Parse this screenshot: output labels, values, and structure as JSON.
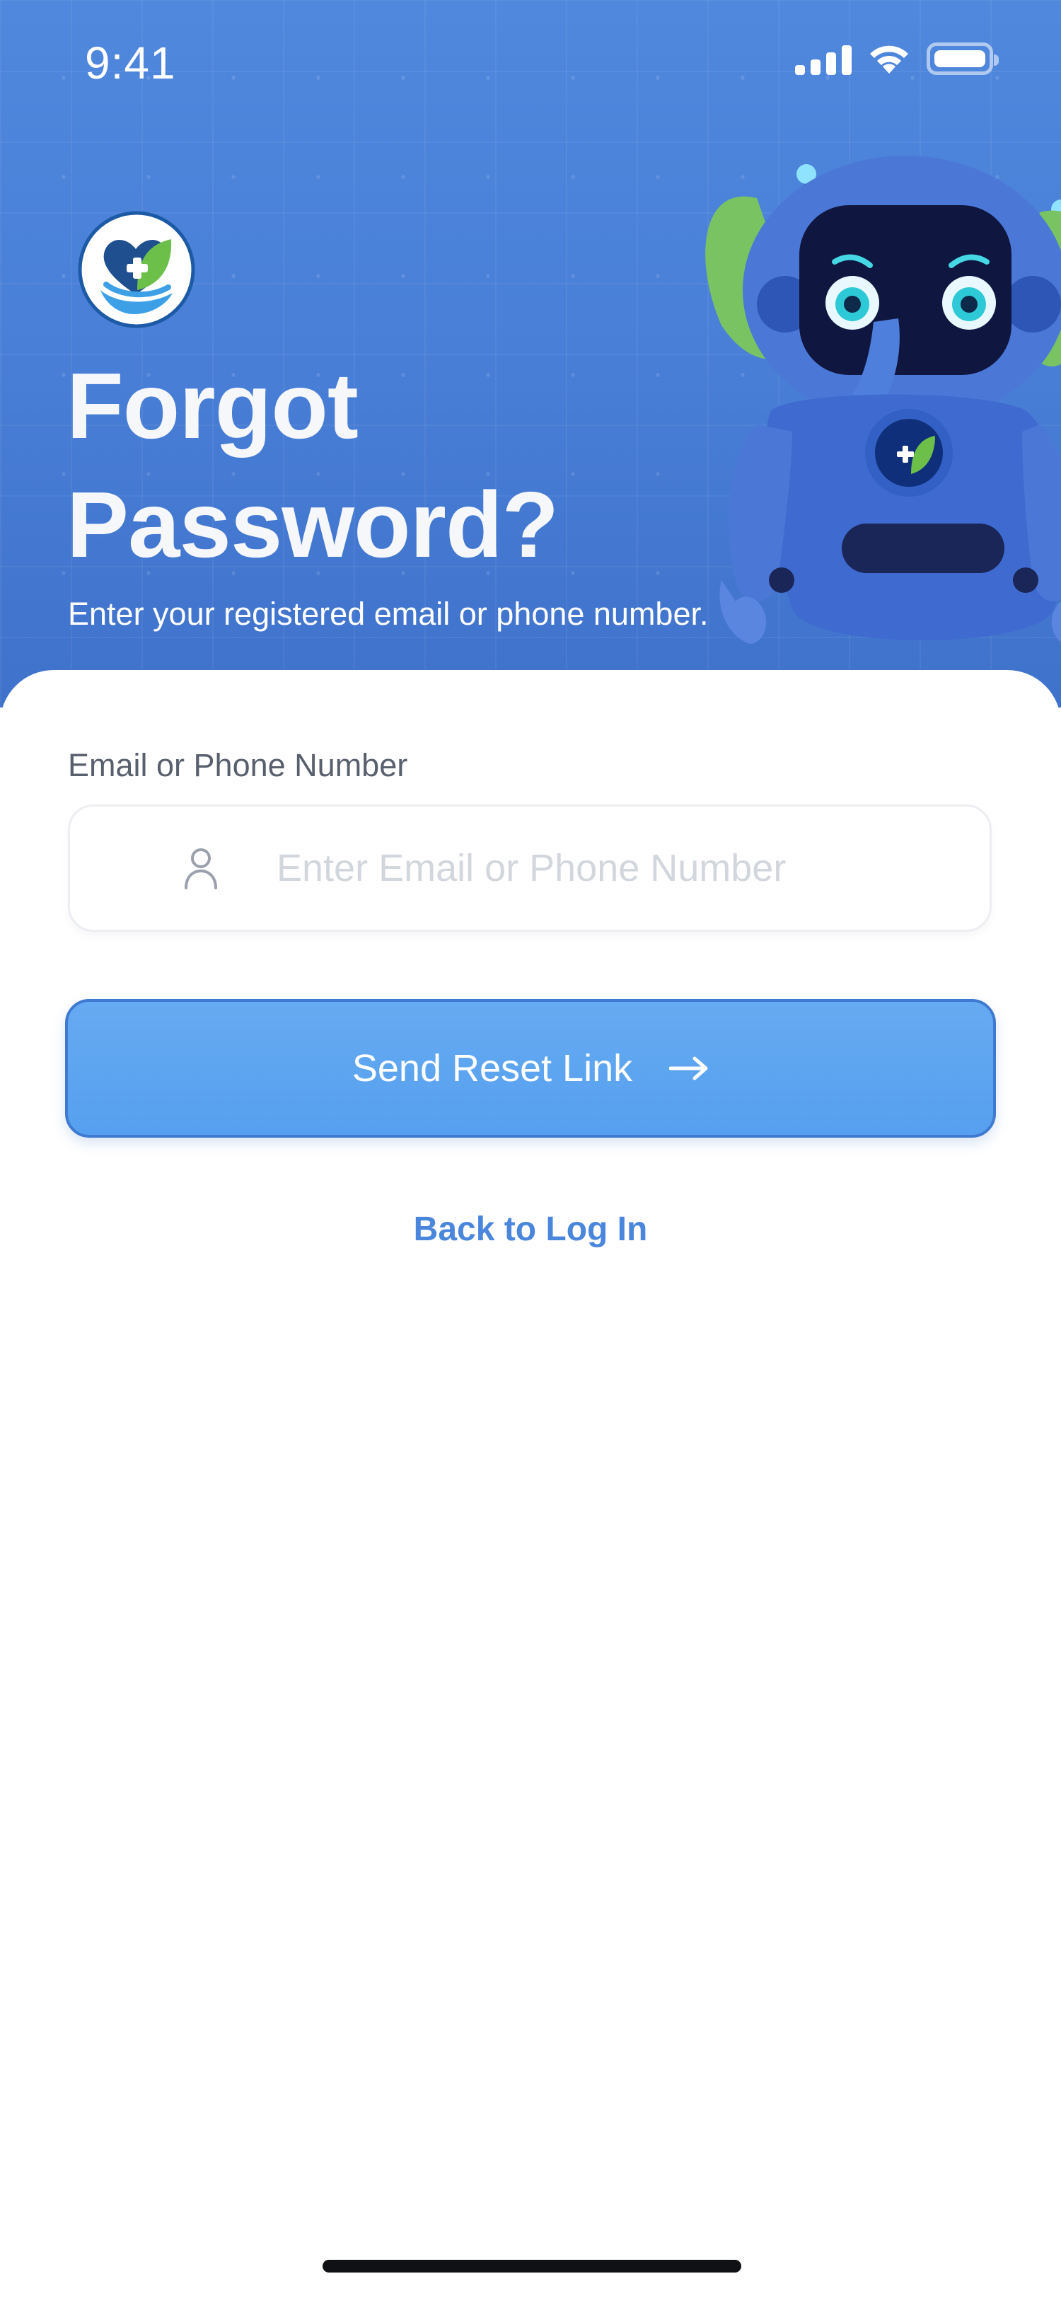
{
  "status_bar": {
    "time": "9:41"
  },
  "header": {
    "title_line1": "Forgot",
    "title_line2": "Password?",
    "subtitle": "Enter your registered email or phone number."
  },
  "form": {
    "label": "Email or Phone Number",
    "placeholder": "Enter Email or Phone Number",
    "value": ""
  },
  "actions": {
    "send_label": "Send Reset Link",
    "back_label": "Back to Log In"
  },
  "icons": {
    "user": "user-icon",
    "arrow": "arrow-right-icon",
    "logo": "heart-leaf-hand-logo-icon",
    "mascot": "robot-elephant-mascot"
  },
  "colors": {
    "header_top": "#4f88dd",
    "header_bottom": "#3f72cb",
    "button": "#58a2ef",
    "button_border": "#3f7ad2",
    "link": "#4a86dc",
    "label": "#59606d",
    "placeholder": "#d2d6dd"
  }
}
